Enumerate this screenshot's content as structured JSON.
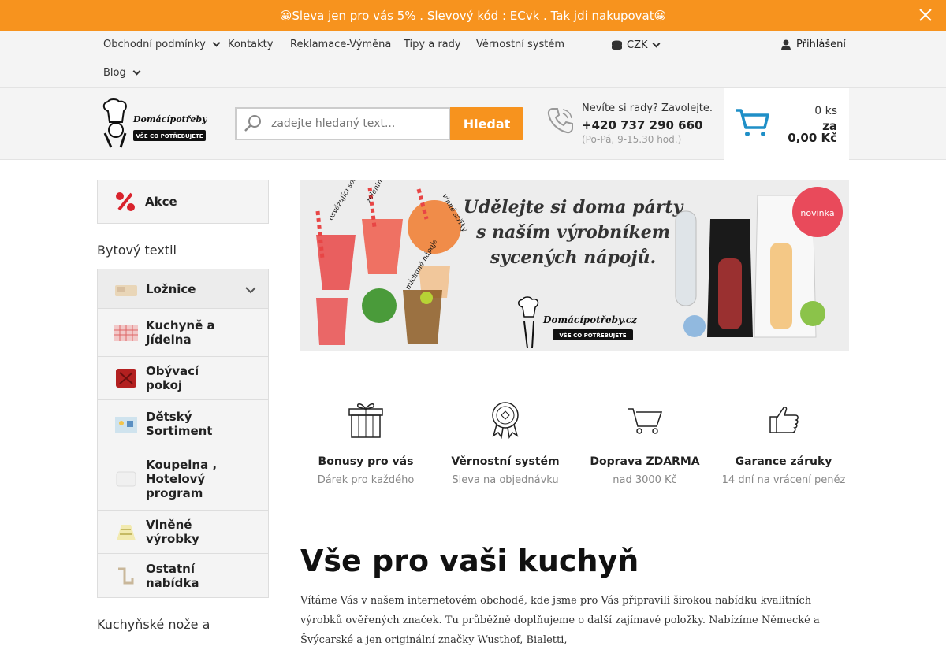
{
  "promo": {
    "text": "😀Sleva jen pro vás 5% . Slevový kód : ECvk . Tak jdi nakupovat😀"
  },
  "topnav": {
    "links": [
      "Obchodní podmínky",
      "Kontakty",
      "Reklamace-Výměna",
      "Tipy a rady",
      "Věrnostní systém",
      "Blog"
    ],
    "currency": "CZK",
    "login": "Přihlášení"
  },
  "header": {
    "logo_text": "Domácípotřeby.cz",
    "logo_tagline": "VŠE CO POTŘEBUJETE",
    "search_placeholder": "zadejte hledaný text...",
    "search_button": "Hledat",
    "phone_question": "Nevíte si rady? Zavolejte.",
    "phone_number": "+420 737 290 660",
    "phone_hours": "(Po-Pá, 9-15.30 hod.)",
    "cart_count": "0 ks",
    "cart_za": "za",
    "cart_price": "0,00 Kč"
  },
  "sidebar": {
    "akce": "Akce",
    "section_title": "Bytový textil",
    "categories": [
      {
        "label": "Ložnice"
      },
      {
        "label": "Kuchyně a Jídelna"
      },
      {
        "label": "Obývací pokoj"
      },
      {
        "label": "Dětský Sortiment"
      },
      {
        "label": "Koupelna , Hotelový program"
      },
      {
        "label": "Vlněné výrobky"
      },
      {
        "label": "Ostatní nabídka"
      }
    ],
    "section2_title": "Kuchyňské nože a"
  },
  "banner": {
    "headline_1": "Udělejte si doma párty",
    "headline_2": "s naším výrobníkem",
    "headline_3": "sycených nápojů.",
    "badge": "novinka",
    "labels": [
      "osvěžující soda",
      "zeleninové a ovocné limonády",
      "vinné střiky",
      "míchané nápoje"
    ],
    "logo_text": "Domácípotřeby.cz",
    "logo_tagline": "VŠE CO POTŘEBUJETE",
    "colors": {
      "badge": "#e94a5b",
      "background": "#ececec"
    }
  },
  "features": [
    {
      "title": "Bonusy pro vás",
      "sub": "Dárek pro každého",
      "icon": "gift-icon"
    },
    {
      "title": "Věrnostní systém",
      "sub": "Sleva na objednávku",
      "icon": "badge-icon"
    },
    {
      "title": "Doprava ZDARMA",
      "sub": "nad 3000 Kč",
      "icon": "cart-icon"
    },
    {
      "title": "Garance záruky",
      "sub": "14 dní na vrácení peněz",
      "icon": "thumbs-up-icon"
    }
  ],
  "content": {
    "heading": "Vše pro vaši kuchyň",
    "intro": "Vítáme Vás v našem internetovém obchodě, kde jsme pro Vás připravili širokou nabídku kvalitních výrobků ověřených značek. Tu průběžně doplňujeme o další zajímavé položky. Nabízíme Německé a Švýcarské a jen originální značky Wusthof, Bialetti,"
  },
  "colors": {
    "accent": "#f7931e",
    "background_grey": "#f4f4f4"
  }
}
